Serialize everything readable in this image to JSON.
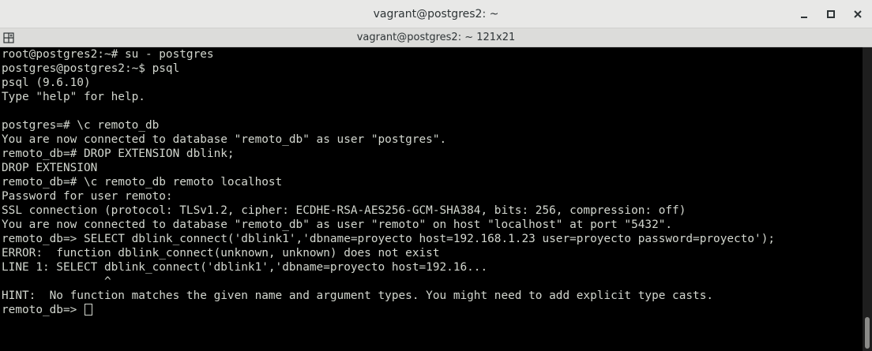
{
  "window": {
    "title": "vagrant@postgres2: ~"
  },
  "tab": {
    "title": "vagrant@postgres2: ~ 121x21"
  },
  "icons": {
    "tab_menu": "new-tab-icon",
    "minimize": "minimize-icon",
    "maximize": "maximize-icon",
    "close": "close-icon"
  },
  "terminal": {
    "lines": [
      "root@postgres2:~# su - postgres",
      "postgres@postgres2:~$ psql",
      "psql (9.6.10)",
      "Type \"help\" for help.",
      "",
      "postgres=# \\c remoto_db",
      "You are now connected to database \"remoto_db\" as user \"postgres\".",
      "remoto_db=# DROP EXTENSION dblink;",
      "DROP EXTENSION",
      "remoto_db=# \\c remoto_db remoto localhost",
      "Password for user remoto:",
      "SSL connection (protocol: TLSv1.2, cipher: ECDHE-RSA-AES256-GCM-SHA384, bits: 256, compression: off)",
      "You are now connected to database \"remoto_db\" as user \"remoto\" on host \"localhost\" at port \"5432\".",
      "remoto_db=> SELECT dblink_connect('dblink1','dbname=proyecto host=192.168.1.23 user=proyecto password=proyecto');",
      "ERROR:  function dblink_connect(unknown, unknown) does not exist",
      "LINE 1: SELECT dblink_connect('dblink1','dbname=proyecto host=192.16...",
      "               ^",
      "HINT:  No function matches the given name and argument types. You might need to add explicit type casts.",
      "remoto_db=> "
    ]
  },
  "colors": {
    "terminal_bg": "#000000",
    "terminal_fg": "#d3d7cf",
    "titlebar_bg": "#e8e8e7"
  }
}
